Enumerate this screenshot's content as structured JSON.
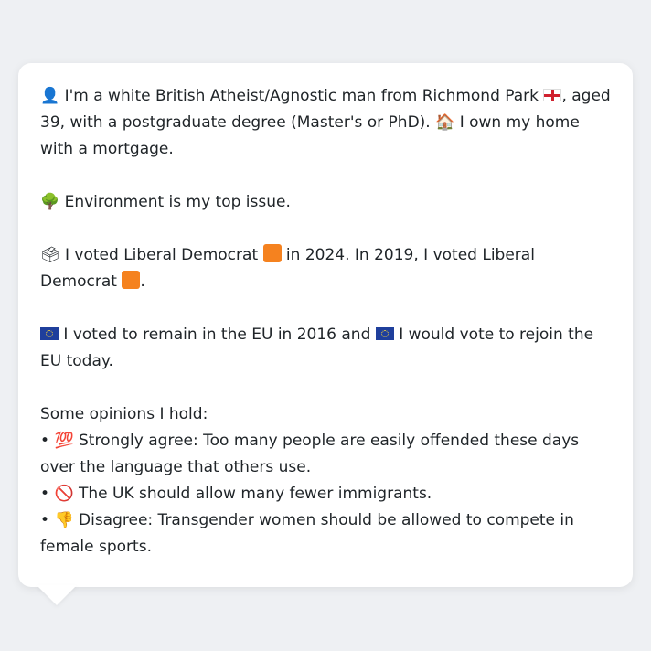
{
  "profile": {
    "intro": {
      "icon": "bust-in-silhouette-icon",
      "part1": "I'm a white British Atheist/Agnostic man from Richmond Park",
      "flag": "england-flag-icon",
      "part2": ", aged 39, with a postgraduate degree (Master's or PhD).",
      "home_icon": "house-icon",
      "part3": "I own my home with a mortgage."
    },
    "top_issue": {
      "icon": "deciduous-tree-icon",
      "text": "Environment is my top issue."
    },
    "voting": {
      "icon": "ballot-box-icon",
      "part1": "I voted Liberal Democrat",
      "party_color": "#f5821f",
      "part2": "in 2024. In 2019, I voted Liberal Democrat",
      "part3": "."
    },
    "eu": {
      "icon": "eu-flag-icon",
      "part1": "I voted to remain in the EU in 2016 and",
      "part2": "I would vote to rejoin the EU today."
    },
    "opinions": {
      "heading": "Some opinions I hold:",
      "items": [
        {
          "bullet": "•",
          "icon": "hundred-points-icon",
          "glyph": "💯",
          "text": "Strongly agree: Too many people are easily offended these days over the language that others use."
        },
        {
          "bullet": "•",
          "icon": "prohibited-icon",
          "glyph": "🚫",
          "text": "The UK should allow many fewer immigrants."
        },
        {
          "bullet": "•",
          "icon": "thumbs-down-icon",
          "glyph": "👎",
          "text": "Disagree: Transgender women should be allowed to compete in female sports."
        }
      ]
    }
  }
}
